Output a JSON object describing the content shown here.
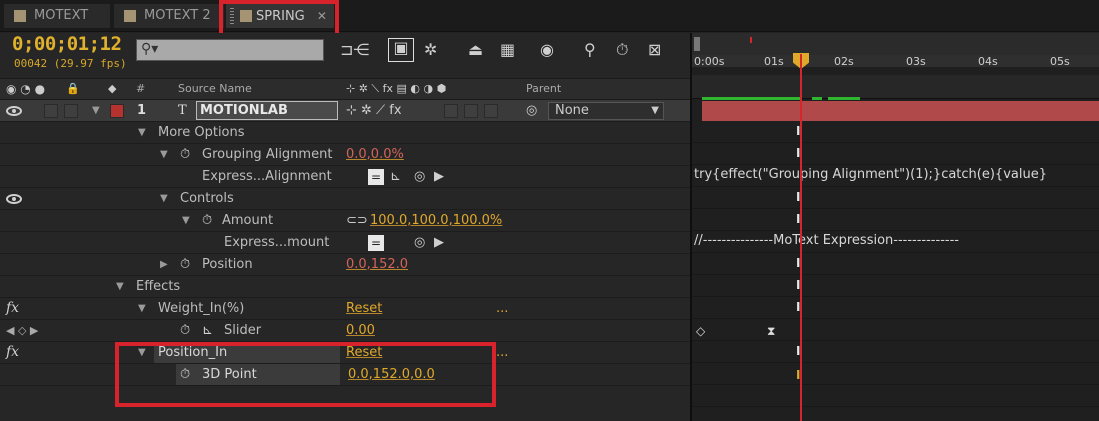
{
  "tabs": [
    {
      "label": "MOTEXT",
      "active": false
    },
    {
      "label": "MOTEXT 2",
      "active": false
    },
    {
      "label": "SPRING",
      "active": true
    }
  ],
  "timecode": "0;00;01;12",
  "frame_info": "00042 (29.97 fps)",
  "search": {
    "value": ""
  },
  "columns": {
    "num": "#",
    "source_name": "Source Name",
    "parent": "Parent"
  },
  "layer": {
    "number": "1",
    "name": "MOTIONLAB",
    "parent": "None"
  },
  "props": {
    "more_options": "More Options",
    "grouping_alignment": "Grouping Alignment",
    "grouping_alignment_value": "0.0,0.0%",
    "express_alignment": "Express...Alignment",
    "controls": "Controls",
    "amount": "Amount",
    "amount_value": "100.0,100.0,100.0%",
    "express_amount": "Express...mount",
    "position": "Position",
    "position_value": "0.0,152.0",
    "effects": "Effects",
    "weight_in": "Weight_In(%)",
    "weight_in_reset": "Reset",
    "weight_in_dots": "...",
    "slider": "Slider",
    "slider_value": "0.00",
    "position_in": "Position_In",
    "position_in_reset": "Reset",
    "position_in_dots": "...",
    "point3d": "3D Point",
    "point3d_value": "0.0,152.0,0.0"
  },
  "ruler": [
    "0:00s",
    "01s",
    "02s",
    "03s",
    "04s",
    "05s"
  ],
  "expressions": {
    "alignment": "try{effect(\"Grouping Alignment\")(1);}catch(e){value}",
    "amount": "//---------------MoText Expression--------------"
  },
  "colors": {
    "accent": "#e0a92b",
    "playhead": "#d4262b",
    "highlight": "#d8222c",
    "layer_bar": "#b04a4a"
  }
}
